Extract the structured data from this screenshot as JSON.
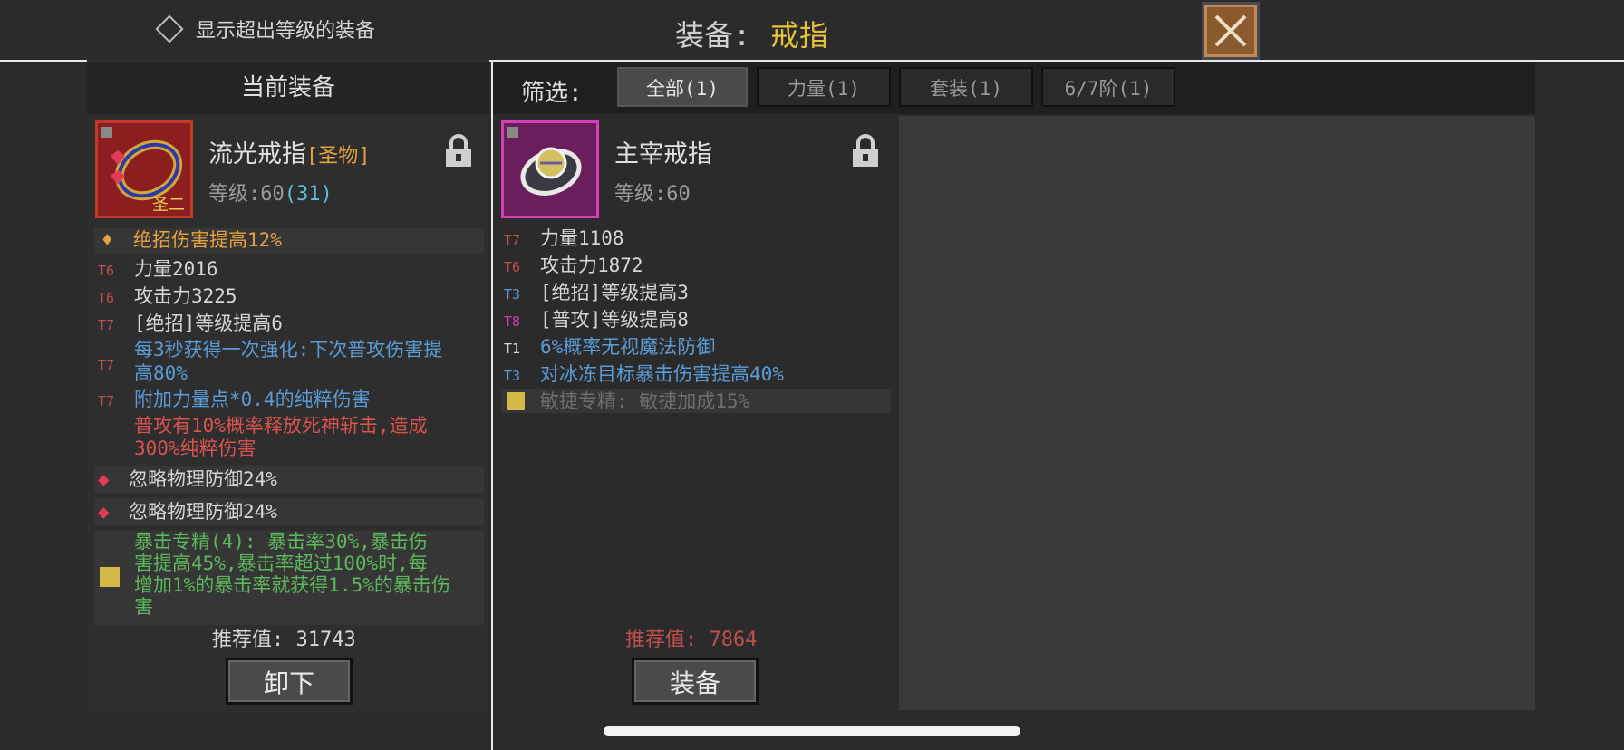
{
  "header": {
    "toggle_label": "显示超出等级的装备",
    "title_label": "装备:",
    "title_value": "戒指"
  },
  "current": {
    "heading": "当前装备",
    "item": {
      "name": "流光戒指",
      "tag": "[圣物]",
      "level_label": "等级:",
      "level": "60",
      "level_extra": "(31)",
      "badge": "圣二",
      "border_color": "#c0392b"
    },
    "stats": [
      {
        "tier": "",
        "text": "绝招伤害提高12%",
        "color": "#e6a23c"
      },
      {
        "tier": "T6",
        "text": "力量2016",
        "color": "#d6d6d6",
        "tier_color": "#c0504d"
      },
      {
        "tier": "T6",
        "text": "攻击力3225",
        "color": "#d6d6d6",
        "tier_color": "#c0504d"
      },
      {
        "tier": "T7",
        "text": "[绝招]等级提高6",
        "color": "#d6d6d6",
        "tier_color": "#c0504d"
      },
      {
        "tier": "T7",
        "text": "每3秒获得一次强化:下次普攻伤害提",
        "text2": "高80%",
        "color": "#5b9bd5",
        "tier_color": "#c0504d"
      },
      {
        "tier": "T7",
        "text": "附加力量点*0.4的纯粹伤害",
        "color": "#5b9bd5",
        "tier_color": "#c0504d"
      },
      {
        "tier": "",
        "text": "普攻有10%概率释放死神斩击,造成",
        "text2": "300%纯粹伤害",
        "color": "#d9534f"
      }
    ],
    "gems": [
      {
        "text": "忽略物理防御24%"
      },
      {
        "text": "忽略物理防御24%"
      }
    ],
    "set_bonus": [
      "暴击专精(4): 暴击率30%,暴击伤",
      "害提高45%,暴击率超过100%时,每",
      "增加1%的暴击率就获得1.5%的暴击伤",
      "害"
    ],
    "set_color": "#5cb85c",
    "rec_label": "推荐值:",
    "rec_value": "31743",
    "button": "卸下"
  },
  "filter": {
    "label": "筛选:",
    "tabs": [
      {
        "label": "全部(1)",
        "active": true
      },
      {
        "label": "力量(1)",
        "active": false
      },
      {
        "label": "套装(1)",
        "active": false
      },
      {
        "label": "6/7阶(1)",
        "active": false
      }
    ]
  },
  "candidate": {
    "item": {
      "name": "主宰戒指",
      "level_label": "等级:",
      "level": "60",
      "border_color": "#d63fb5"
    },
    "stats": [
      {
        "tier": "T7",
        "text": "力量1108",
        "color": "#d6d6d6",
        "tier_color": "#c0504d"
      },
      {
        "tier": "T6",
        "text": "攻击力1872",
        "color": "#d6d6d6",
        "tier_color": "#c0504d"
      },
      {
        "tier": "T3",
        "text": "[绝招]等级提高3",
        "color": "#d6d6d6",
        "tier_color": "#5b9bd5"
      },
      {
        "tier": "T8",
        "text": "[普攻]等级提高8",
        "color": "#d6d6d6",
        "tier_color": "#d63fb5"
      },
      {
        "tier": "T1",
        "text": "6%概率无视魔法防御",
        "color": "#5b9bd5",
        "tier_color": "#d6d6d6"
      },
      {
        "tier": "T3",
        "text": "对冰冻目标暴击伤害提高40%",
        "color": "#5b9bd5",
        "tier_color": "#5b9bd5"
      }
    ],
    "set_bonus": "敏捷专精: 敏捷加成15%",
    "set_color": "#6e6e6e",
    "rec_label": "推荐值:",
    "rec_value": "7864",
    "rec_color": "#c0504d",
    "button": "装备"
  }
}
